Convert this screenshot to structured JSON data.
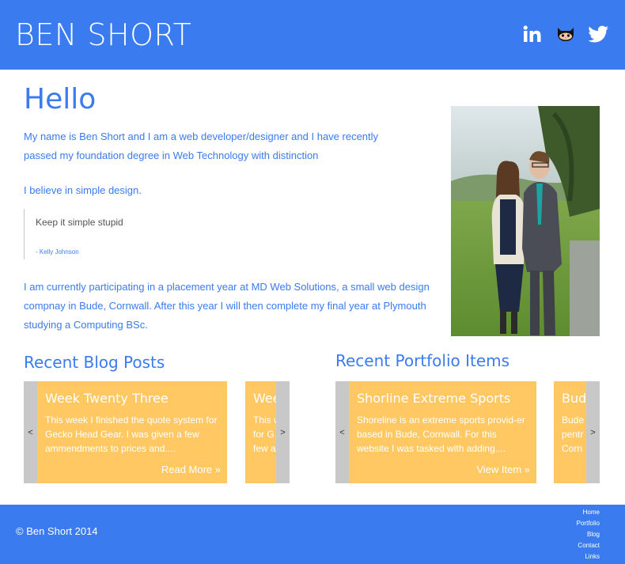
{
  "header": {
    "title": "BEN SHORT",
    "social": [
      "linkedin-icon",
      "github-icon",
      "twitter-icon"
    ],
    "bg_color": "#3b7bf0"
  },
  "main": {
    "heading": "Hello",
    "intro": "My name is Ben Short and I am a web developer/designer and I have recently passed my foundation degree in Web Technology with distinction",
    "simple": "I believe in simple design.",
    "quote": {
      "text": "Keep it simple stupid",
      "author": "- Kelly Johnson"
    },
    "placement_before": "I am currently participating in a placement year at ",
    "placement_link": "MD Web Solutions",
    "placement_after": ", a small web design compnay in Bude, Cornwall.  After this year I will then complete my final year at Plymouth studying a Computing BSc."
  },
  "blog": {
    "title": "Recent Blog Posts",
    "prev": "<",
    "next": ">",
    "card": {
      "title": "Week Twenty Three",
      "body": "This week I finished the quote system for Gecko Head Gear. I was given a few ammendments to prices and....",
      "link": "Read More »"
    },
    "peek": {
      "title": "Wee",
      "body": "This w for G few a"
    }
  },
  "portfolio": {
    "title": "Recent Portfolio Items",
    "prev": "<",
    "next": ">",
    "card": {
      "title": "Shorline Extreme Sports",
      "body": "Shoreline is an extreme sports provid-er based in Bude, Cornwall. For this website I was tasked with adding....",
      "link": "View Item »"
    },
    "peek": {
      "title": "Bude",
      "body": "Bude pentr Corn"
    }
  },
  "footer": {
    "copyright": "© Ben Short 2014",
    "nav": [
      "Home",
      "Portfolio",
      "Blog",
      "Contact",
      "Links"
    ]
  },
  "colors": {
    "accent": "#3b7bf0",
    "card": "#ffc862",
    "arrow": "#c8c8c8"
  }
}
